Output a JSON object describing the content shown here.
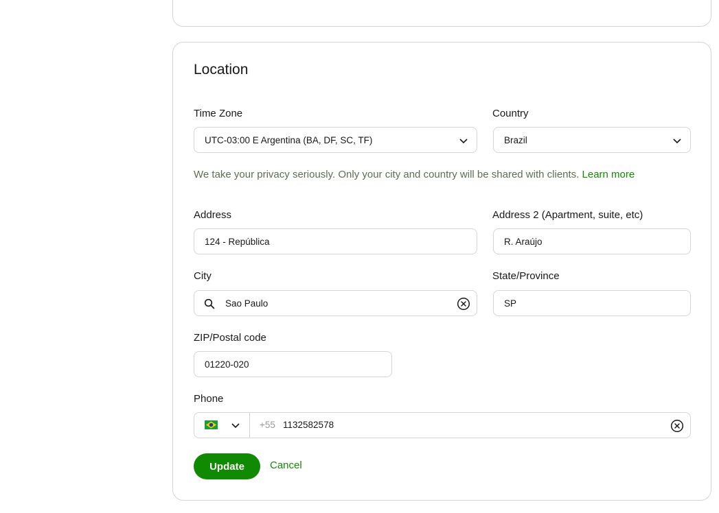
{
  "location": {
    "title": "Location",
    "time_zone": {
      "label": "Time Zone",
      "value": "UTC-03:00 E Argentina (BA, DF, SC, TF)"
    },
    "country": {
      "label": "Country",
      "value": "Brazil"
    },
    "privacy": {
      "text": "We take your privacy seriously. Only your city and country will be shared with clients.",
      "link": "Learn more"
    },
    "address": {
      "label": "Address",
      "value": "124 - República"
    },
    "address2": {
      "label": "Address 2 (Apartment, suite, etc)",
      "value": "R. Araújo"
    },
    "city": {
      "label": "City",
      "value": "Sao Paulo"
    },
    "state": {
      "label": "State/Province",
      "value": "SP"
    },
    "zip": {
      "label": "ZIP/Postal code",
      "value": "01220-020"
    },
    "phone": {
      "label": "Phone",
      "country_code": "+55",
      "value": "1132582578",
      "flag": "brazil-flag-icon"
    },
    "actions": {
      "update": "Update",
      "cancel": "Cancel"
    },
    "colors": {
      "accent": "#108a00",
      "border": "#d5d5d5",
      "muted_text": "#5e6d55"
    }
  }
}
